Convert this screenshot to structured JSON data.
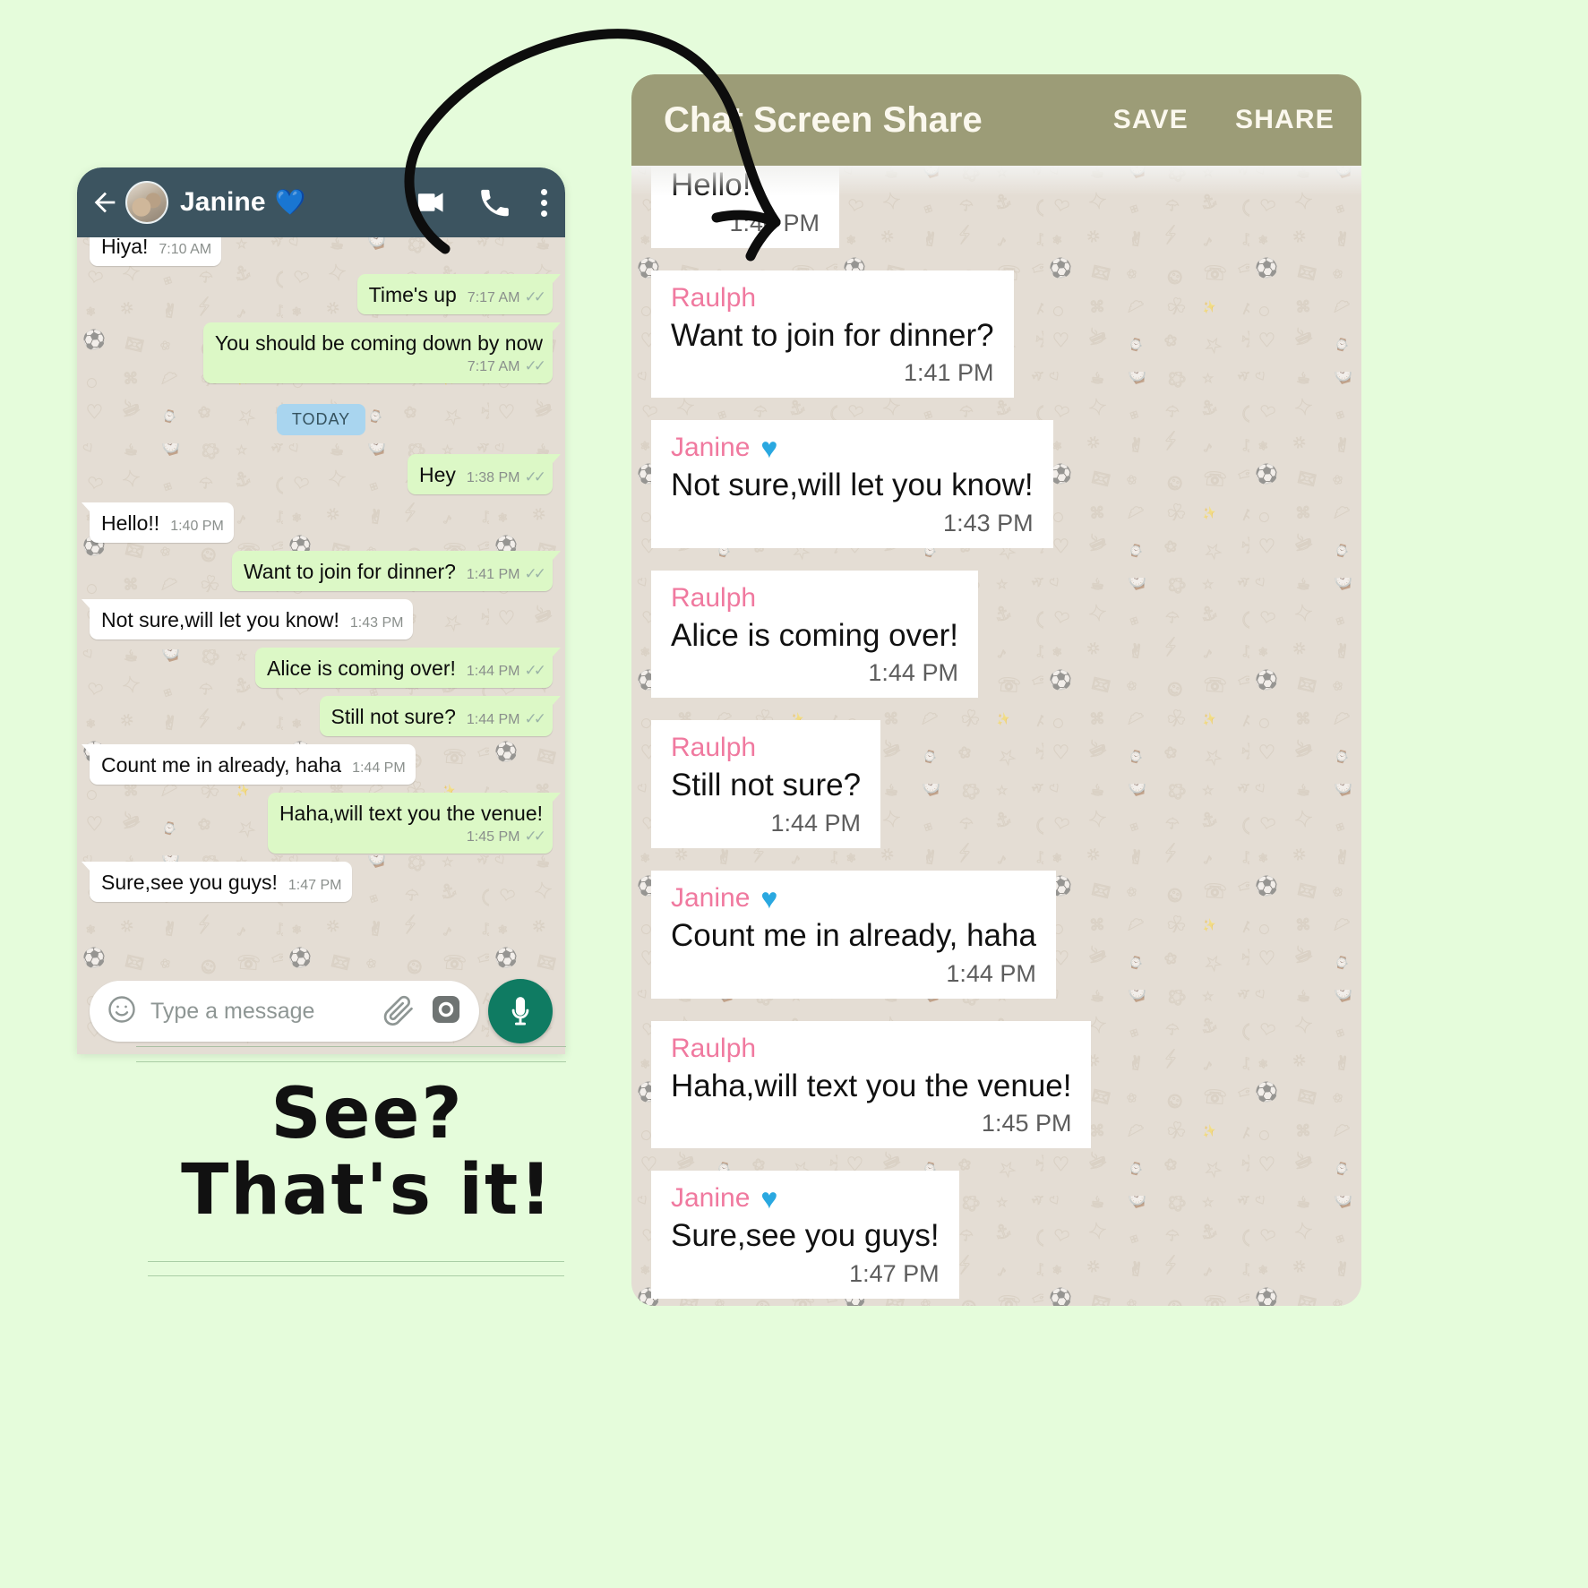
{
  "page": {
    "background_color": "#e5fcdb",
    "annotation_arrow": "hand-drawn-curved-arrow"
  },
  "caption": {
    "line1": "See?",
    "line2": "That's it!"
  },
  "whatsapp": {
    "header": {
      "contact_name": "Janine",
      "heart_emoji": "💙",
      "back_icon": "back-arrow-icon",
      "video_icon": "video-call-icon",
      "call_icon": "phone-call-icon",
      "overflow_icon": "more-options-icon",
      "bar_color": "#3c5460"
    },
    "day_divider": "TODAY",
    "messages": [
      {
        "side": "in",
        "text": "Hiya!",
        "time": "7:10 AM",
        "ticks": "",
        "wrap": false,
        "clipped": true
      },
      {
        "side": "out",
        "text": "Time's up",
        "time": "7:17 AM",
        "ticks": "✓✓",
        "wrap": false
      },
      {
        "side": "out",
        "text": "You should be coming down by now",
        "time": "7:17 AM",
        "ticks": "✓✓",
        "wrap": true
      },
      {
        "side": "out",
        "text": "Hey",
        "time": "1:38 PM",
        "ticks": "✓✓",
        "wrap": false
      },
      {
        "side": "in",
        "text": "Hello!!",
        "time": "1:40 PM",
        "ticks": "",
        "wrap": false
      },
      {
        "side": "out",
        "text": "Want to join for dinner?",
        "time": "1:41 PM",
        "ticks": "✓✓",
        "wrap": false
      },
      {
        "side": "in",
        "text": "Not sure,will let you know!",
        "time": "1:43 PM",
        "ticks": "",
        "wrap": false
      },
      {
        "side": "out",
        "text": "Alice is coming over!",
        "time": "1:44 PM",
        "ticks": "✓✓",
        "wrap": false
      },
      {
        "side": "out",
        "text": "Still not sure?",
        "time": "1:44 PM",
        "ticks": "✓✓",
        "wrap": false
      },
      {
        "side": "in",
        "text": "Count me in already, haha",
        "time": "1:44 PM",
        "ticks": "",
        "wrap": false
      },
      {
        "side": "out",
        "text": "Haha,will text you the venue!",
        "time": "1:45 PM",
        "ticks": "✓✓",
        "wrap": true
      },
      {
        "side": "in",
        "text": "Sure,see you guys!",
        "time": "1:47 PM",
        "ticks": "",
        "wrap": false
      }
    ],
    "composer": {
      "placeholder": "Type a message",
      "emoji_icon": "emoji-smiley-icon",
      "attach_icon": "paperclip-attach-icon",
      "camera_icon": "camera-icon",
      "mic_icon": "microphone-icon",
      "mic_button_color": "#0f7b62"
    }
  },
  "share_panel": {
    "title": "Chat Screen Share",
    "save_label": "SAVE",
    "share_label": "SHARE",
    "header_color": "#9c9c77",
    "sender_name_color": "#f0799f",
    "cards": [
      {
        "sender": "",
        "heart": false,
        "text": "Hello!",
        "time": "1:40 PM",
        "clipped": true
      },
      {
        "sender": "Raulph",
        "heart": false,
        "text": "Want to join for dinner?",
        "time": "1:41 PM"
      },
      {
        "sender": "Janine",
        "heart": true,
        "text": "Not sure,will let you know!",
        "time": "1:43 PM"
      },
      {
        "sender": "Raulph",
        "heart": false,
        "text": "Alice is coming over!",
        "time": "1:44 PM"
      },
      {
        "sender": "Raulph",
        "heart": false,
        "text": "Still not sure?",
        "time": "1:44 PM"
      },
      {
        "sender": "Janine",
        "heart": true,
        "text": "Count me in already, haha",
        "time": "1:44 PM"
      },
      {
        "sender": "Raulph",
        "heart": false,
        "text": "Haha,will text you the venue!",
        "time": "1:45 PM"
      },
      {
        "sender": "Janine",
        "heart": true,
        "text": "Sure,see you guys!",
        "time": "1:47 PM"
      }
    ]
  }
}
